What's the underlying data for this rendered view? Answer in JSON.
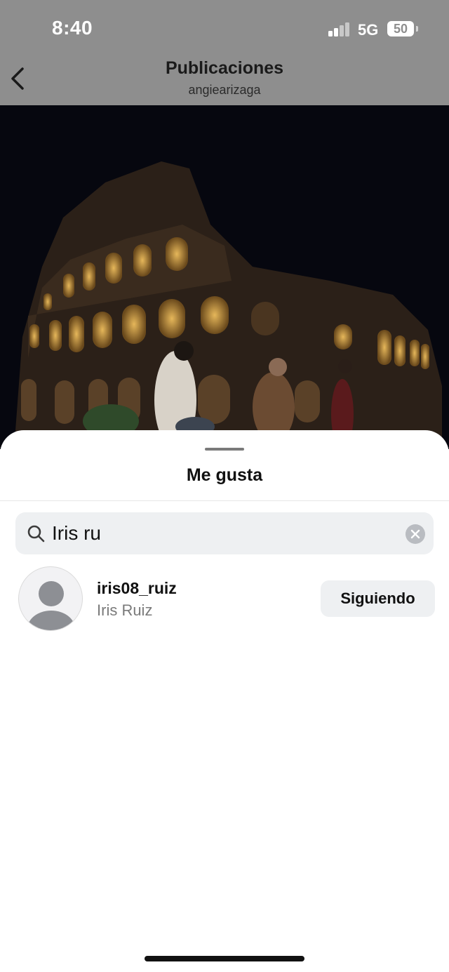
{
  "status_bar": {
    "time": "8:40",
    "network": "5G",
    "battery": "50"
  },
  "header": {
    "title": "Publicaciones",
    "subtitle": "angiearizaga"
  },
  "sheet": {
    "title": "Me gusta",
    "search": {
      "value": "Iris ru"
    },
    "results": [
      {
        "username": "iris08_ruiz",
        "full_name": "Iris Ruiz",
        "button_label": "Siguiendo"
      }
    ]
  },
  "colors": {
    "overlay_gray": "#8e8e8e",
    "sheet_background": "#ffffff",
    "field_background": "#eef0f2"
  }
}
